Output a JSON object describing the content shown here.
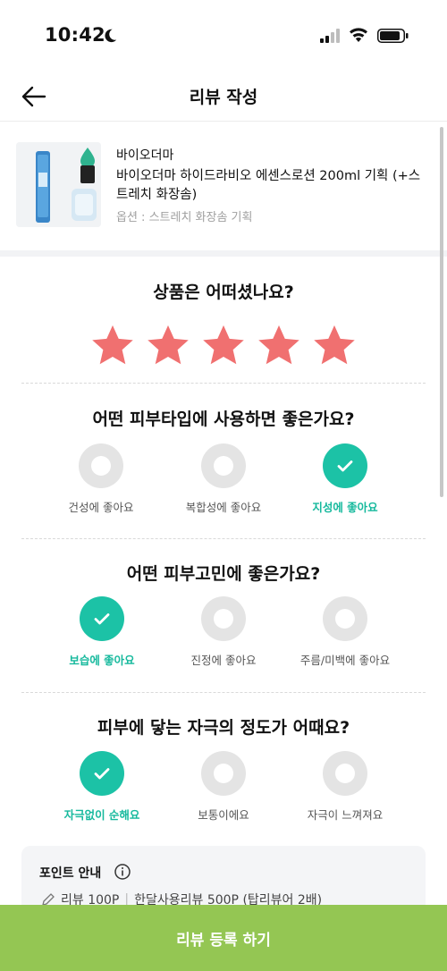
{
  "status_bar": {
    "time": "10:42"
  },
  "header": {
    "title": "리뷰 작성"
  },
  "product": {
    "brand": "바이오더마",
    "name": "바이오더마 하이드라비오 에센스로션 200ml 기획 (+스트레치 화장솜)",
    "option": "옵션 : 스트레치 화장솜 기획"
  },
  "rating": {
    "question": "상품은 어떠셨나요?",
    "value": 5,
    "max": 5,
    "star_color": "#f07070"
  },
  "skin_type": {
    "question": "어떤 피부타입에 사용하면 좋은가요?",
    "options": [
      {
        "label": "건성에 좋아요",
        "selected": false
      },
      {
        "label": "복합성에 좋아요",
        "selected": false
      },
      {
        "label": "지성에 좋아요",
        "selected": true
      }
    ]
  },
  "skin_concern": {
    "question": "어떤 피부고민에 좋은가요?",
    "options": [
      {
        "label": "보습에 좋아요",
        "selected": true
      },
      {
        "label": "진정에 좋아요",
        "selected": false
      },
      {
        "label": "주름/미백에 좋아요",
        "selected": false
      }
    ]
  },
  "irritation": {
    "question": "피부에 닿는 자극의 정도가 어때요?",
    "options": [
      {
        "label": "자극없이 순해요",
        "selected": true
      },
      {
        "label": "보통이에요",
        "selected": false
      },
      {
        "label": "자극이 느껴져요",
        "selected": false
      }
    ]
  },
  "points": {
    "title": "포인트 안내",
    "review": "리뷰 100P",
    "month_review": "한달사용리뷰 500P (탑리뷰어 2배)"
  },
  "submit": {
    "label": "리뷰 등록 하기"
  },
  "colors": {
    "accent": "#1cc2a6",
    "submit_bg": "#94c653",
    "star": "#f07070"
  }
}
